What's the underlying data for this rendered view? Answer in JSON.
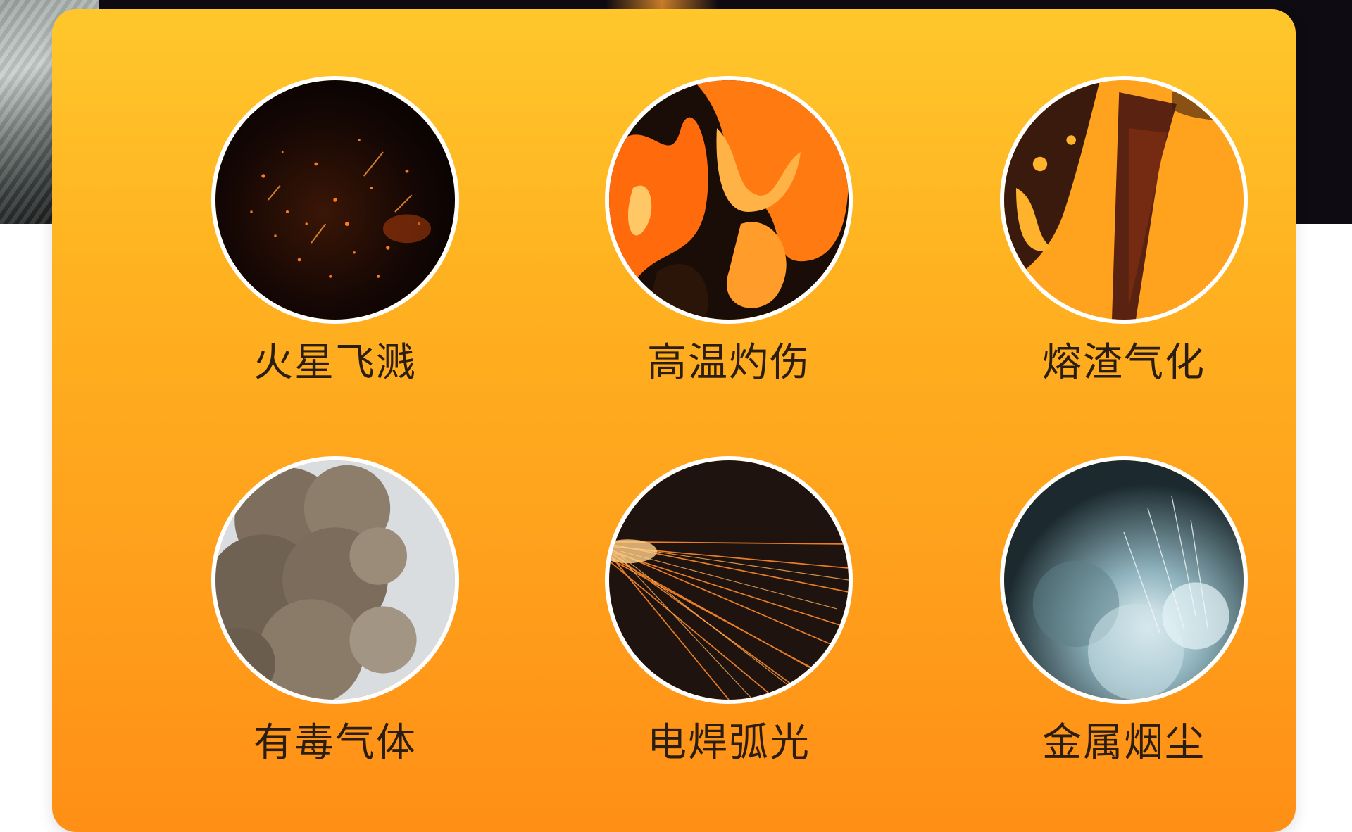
{
  "hazards": [
    {
      "label": "火星飞溅",
      "icon": "sparks-photo-icon"
    },
    {
      "label": "高温灼伤",
      "icon": "flames-photo-icon"
    },
    {
      "label": "熔渣气化",
      "icon": "molten-slag-photo-icon"
    },
    {
      "label": "有毒气体",
      "icon": "toxic-smoke-photo-icon"
    },
    {
      "label": "电焊弧光",
      "icon": "welding-arc-photo-icon"
    },
    {
      "label": "金属烟尘",
      "icon": "metal-fume-photo-icon"
    }
  ],
  "colors": {
    "card_top": "#ffc72c",
    "card_bottom": "#ff8f16",
    "label_text": "#2b1e10",
    "ring": "#ffffff"
  }
}
